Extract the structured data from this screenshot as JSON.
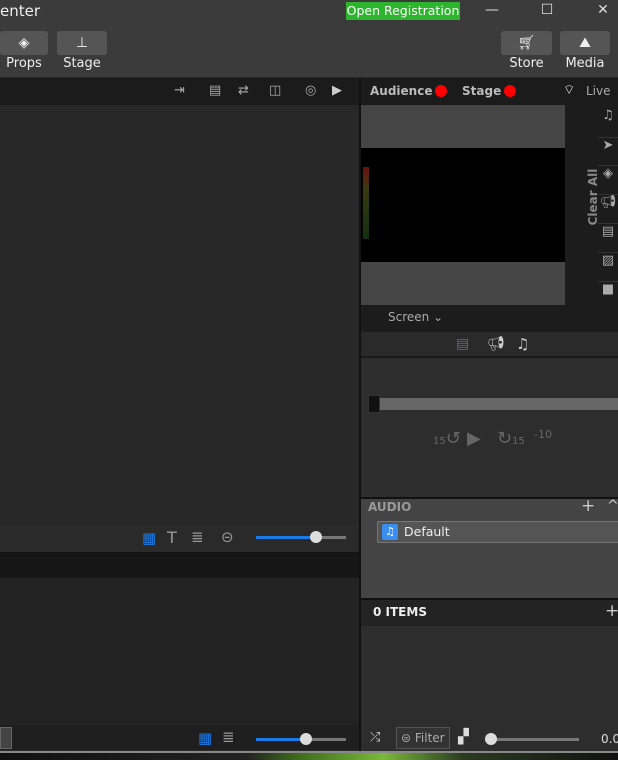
{
  "window": {
    "title": "enter",
    "register_label": "Open Registration",
    "minimize": "—",
    "maximize": "☐",
    "close": "✕"
  },
  "toolbar": {
    "props": "Props",
    "stage": "Stage",
    "store": "Store",
    "media": "Media"
  },
  "output": {
    "audience": "Audience",
    "stage": "Stage",
    "live": "Live",
    "clear_all": "Clear All",
    "screen_select": "Screen",
    "status_color": "#ff0000"
  },
  "player": {
    "rewind": "15",
    "forward": "15",
    "skip": "-10"
  },
  "audio": {
    "header": "AUDIO",
    "playlist": "Default"
  },
  "items": {
    "header": "0 ITEMS",
    "filter": "Filter",
    "volume": "0.0"
  },
  "sliders": {
    "slides_zoom": 0.75,
    "library_zoom": 0.65,
    "volume": 0.0
  },
  "colors": {
    "accent": "#1a7ae8",
    "register": "#2db52d"
  }
}
